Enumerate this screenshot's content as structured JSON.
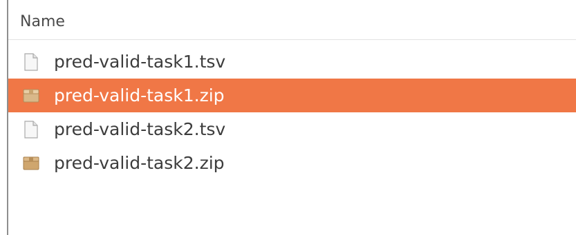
{
  "file_list": {
    "column_header": "Name",
    "selection_color": "#f07746",
    "items": [
      {
        "name": "pred-valid-task1.tsv",
        "icon": "text-file-icon",
        "selected": false
      },
      {
        "name": "pred-valid-task1.zip",
        "icon": "archive-icon",
        "selected": true
      },
      {
        "name": "pred-valid-task2.tsv",
        "icon": "text-file-icon",
        "selected": false
      },
      {
        "name": "pred-valid-task2.zip",
        "icon": "archive-icon",
        "selected": false
      }
    ]
  }
}
